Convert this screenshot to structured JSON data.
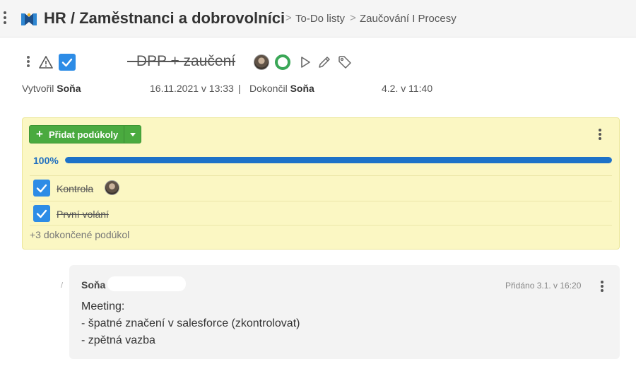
{
  "header": {
    "title": "HR / Zaměstnanci a dobrovolníci",
    "breadcrumb": [
      "To-Do listy",
      "Zaučování I Procesy"
    ],
    "separator": ">"
  },
  "task": {
    "title": "- DPP + zaučení",
    "created_label": "Vytvořil",
    "created_by": "Soňa",
    "created_at": "16.11.2021 v 13:33",
    "divider": "|",
    "completed_label": "Dokončil",
    "completed_by": "Soňa",
    "completed_at": "4.2. v 11:40",
    "done": true
  },
  "subtasks": {
    "add_button": "Přidat podúkoly",
    "progress_label": "100%",
    "progress": 1.0,
    "items": [
      {
        "label": "Kontrola",
        "done": true,
        "has_avatar": true
      },
      {
        "label": "První volání",
        "done": true,
        "has_avatar": false
      }
    ],
    "more_done": "+3 dokončené podúkol"
  },
  "comment": {
    "author": "Soňa",
    "date": "Přidáno 3.1. v 16:20",
    "lines": [
      "Meeting:",
      "- špatné značení v salesforce (zkontrolovat)",
      "- zpětná vazba"
    ]
  },
  "colors": {
    "accent_blue": "#2d8ce6",
    "progress_blue": "#1d72c8",
    "add_green": "#4aaa3f",
    "done_ring_green": "#3aa757",
    "card_yellow": "#fbf7c3"
  },
  "icons": [
    "kebab-icon",
    "app-logo-icon",
    "warning-icon",
    "checkbox-checked-icon",
    "status-ring-icon",
    "play-icon",
    "pencil-icon",
    "tag-icon",
    "plus-icon",
    "caret-down-icon"
  ]
}
